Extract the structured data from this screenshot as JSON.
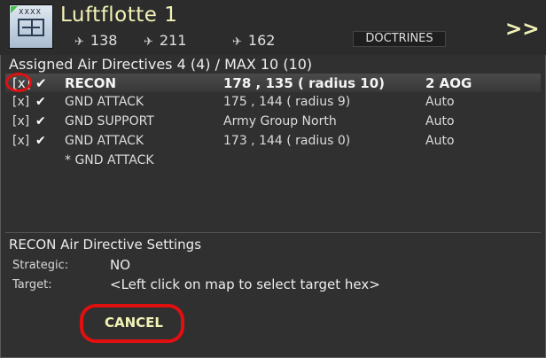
{
  "header": {
    "unit_type_tag": "XXXX",
    "title": "Luftflotte 1",
    "counts": [
      {
        "icon": "fighter-plane-icon",
        "value": "138"
      },
      {
        "icon": "bomber-plane-icon",
        "value": "211"
      },
      {
        "icon": "transport-plane-icon",
        "value": "162"
      }
    ],
    "doctrines_label": "DOCTRINES",
    "next_label": ">>"
  },
  "assigned": {
    "heading": "Assigned Air Directives 4 (4) / MAX 10 (10)"
  },
  "directives": [
    {
      "flag": "[x]",
      "mission": "RECON",
      "location": "178 , 135 ( radius 10)",
      "assignment": "2 AOG",
      "selected": true
    },
    {
      "flag": "[x]",
      "mission": "GND ATTACK",
      "location": "175 , 144 ( radius 9)",
      "assignment": "Auto",
      "selected": false
    },
    {
      "flag": "[x]",
      "mission": "GND SUPPORT",
      "location": "Army Group North",
      "assignment": "Auto",
      "selected": false
    },
    {
      "flag": "[x]",
      "mission": "GND ATTACK",
      "location": "173 , 144 ( radius 0)",
      "assignment": "Auto",
      "selected": false
    }
  ],
  "pending_directive": "* GND ATTACK",
  "settings": {
    "heading": "RECON Air Directive Settings",
    "strategic_label": "Strategic:",
    "strategic_value": "NO",
    "target_label": "Target:",
    "target_value": "<Left click on map to select target hex>",
    "cancel_label": "CANCEL"
  },
  "highlights": {
    "color": "#e01010"
  },
  "colors": {
    "accent": "#f2f2b6",
    "background": "#2e2e2e"
  }
}
